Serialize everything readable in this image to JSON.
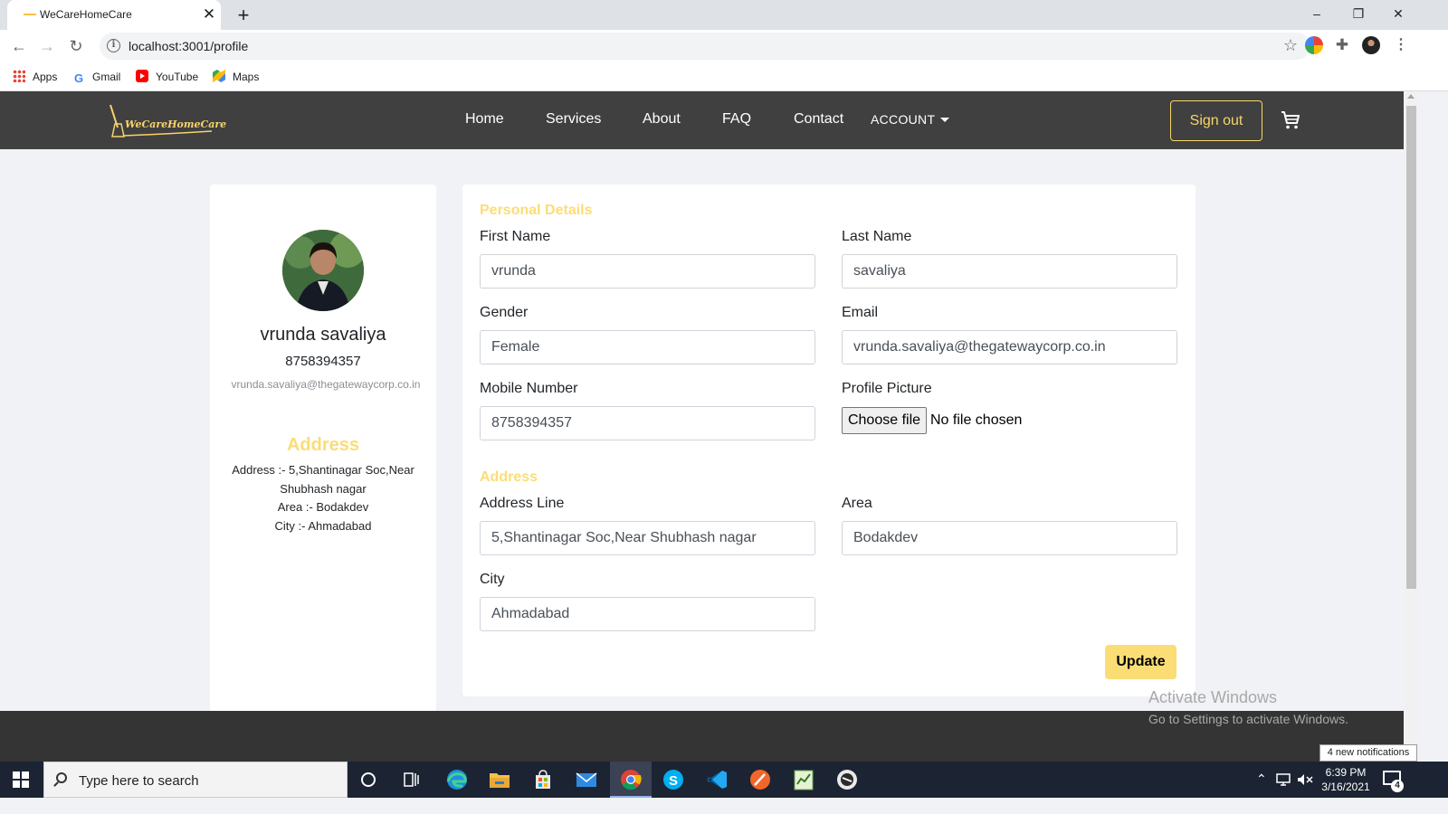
{
  "browser": {
    "tab_title": "WeCareHomeCare",
    "tab_close": "✕",
    "new_tab": "+",
    "url": "localhost:3001/profile",
    "bookmarks": [
      "Apps",
      "Gmail",
      "YouTube",
      "Maps"
    ],
    "window_controls": [
      "–",
      "❐",
      "✕"
    ]
  },
  "navbar": {
    "logo_text": "WeCareHomeCare",
    "links": [
      "Home",
      "Services",
      "About",
      "FAQ",
      "Contact"
    ],
    "account_label": "ACCOUNT",
    "signout_label": "Sign out",
    "cart_icon": "cart-icon"
  },
  "profile_card": {
    "name": "vrunda savaliya",
    "phone": "8758394357",
    "email": "vrunda.savaliya@thegatewaycorp.co.in",
    "address_heading": "Address",
    "address_lines": [
      "Address :- 5,Shantinagar Soc,Near",
      "Shubhash nagar",
      "Area :- Bodakdev",
      "City :- Ahmadabad"
    ]
  },
  "form": {
    "personal_heading": "Personal Details",
    "first_name": {
      "label": "First Name",
      "value": "vrunda"
    },
    "last_name": {
      "label": "Last Name",
      "value": "savaliya"
    },
    "gender": {
      "label": "Gender",
      "value": "Female"
    },
    "email": {
      "label": "Email",
      "value": "vrunda.savaliya@thegatewaycorp.co.in"
    },
    "mobile": {
      "label": "Mobile Number",
      "value": "8758394357"
    },
    "profile_picture": {
      "label": "Profile Picture",
      "button": "Choose file",
      "status": "No file chosen"
    },
    "address_heading": "Address",
    "address_line": {
      "label": "Address Line",
      "value": "5,Shantinagar Soc,Near Shubhash nagar"
    },
    "area": {
      "label": "Area",
      "value": "Bodakdev"
    },
    "city": {
      "label": "City",
      "value": "Ahmadabad"
    },
    "update_label": "Update"
  },
  "watermark": {
    "title": "Activate Windows",
    "subtitle": "Go to Settings to activate Windows."
  },
  "taskbar": {
    "search_placeholder": "Type here to search",
    "notification_tip": "4 new notifications",
    "time": "6:39 PM",
    "date": "3/16/2021",
    "notification_count": "4"
  },
  "colors": {
    "navbar_bg": "#404040",
    "accent": "#fbdd76",
    "footer_bg": "#343434",
    "page_bg": "#f0f2f5"
  }
}
